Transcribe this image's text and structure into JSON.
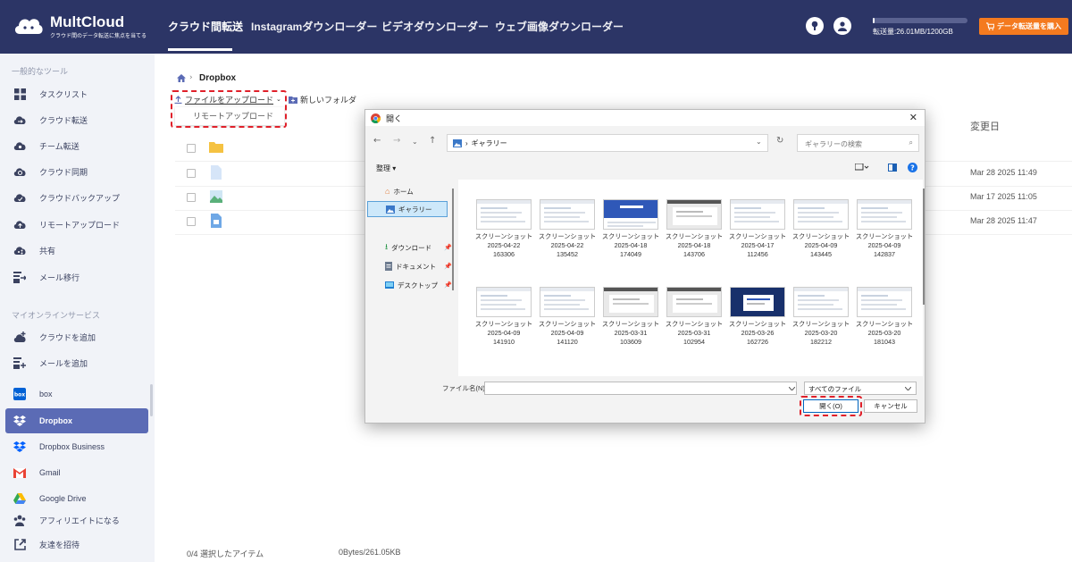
{
  "app": {
    "name": "MultCloud",
    "tagline": "クラウド間のデータ転送に焦点を当てる"
  },
  "nav": {
    "items": [
      {
        "label": "クラウド間転送",
        "active": true
      },
      {
        "label": "Instagramダウンローダー"
      },
      {
        "label": "ビデオダウンローダー"
      },
      {
        "label": "ウェブ画像ダウンローダー"
      }
    ]
  },
  "header": {
    "usage_text": "転送量:26.01MB/1200GB",
    "usage_fraction": 2e-05,
    "transfer_button": "データ転送量を購入",
    "icons": [
      "help-icon",
      "user-icon",
      "cart-icon"
    ]
  },
  "sidebar": {
    "section_tools": "一般的なツール",
    "tools": [
      {
        "label": "タスクリスト",
        "icon": "grid-icon"
      },
      {
        "label": "クラウド転送",
        "icon": "cloud-transfer-icon"
      },
      {
        "label": "チーム転送",
        "icon": "team-transfer-icon"
      },
      {
        "label": "クラウド同期",
        "icon": "cloud-sync-icon"
      },
      {
        "label": "クラウドバックアップ",
        "icon": "cloud-backup-icon"
      },
      {
        "label": "リモートアップロード",
        "icon": "remote-upload-icon"
      },
      {
        "label": "共有",
        "icon": "share-icon"
      },
      {
        "label": "メール移行",
        "icon": "mail-migrate-icon"
      }
    ],
    "section_services": "マイオンラインサービス",
    "services_actions": [
      {
        "label": "クラウドを追加",
        "icon": "add-cloud-icon"
      },
      {
        "label": "メールを追加",
        "icon": "add-mail-icon"
      }
    ],
    "services": [
      {
        "label": "box",
        "icon": "box-icon"
      },
      {
        "label": "Dropbox",
        "icon": "dropbox-icon",
        "active": true
      },
      {
        "label": "Dropbox Business",
        "icon": "dropbox-icon"
      },
      {
        "label": "Gmail",
        "icon": "gmail-icon"
      },
      {
        "label": "Google Drive",
        "icon": "google-drive-icon"
      }
    ],
    "footer": [
      {
        "label": "アフィリエイトになる",
        "icon": "affiliate-icon"
      },
      {
        "label": "友達を招待",
        "icon": "invite-icon"
      }
    ]
  },
  "main": {
    "breadcrumb": "Dropbox",
    "upload_label": "ファイルをアップロード",
    "new_folder_label": "新しいフォルダ",
    "dropdown_item": "リモートアップロード",
    "col_date": "変更日",
    "rows": [
      {
        "date": ""
      },
      {
        "date": "Mar 28 2025 11:49"
      },
      {
        "date": "Mar 17 2025 11:05"
      },
      {
        "date": "Mar 28 2025 11:47"
      }
    ],
    "status_selected": "0/4 選択したアイテム",
    "status_size": "0Bytes/261.05KB"
  },
  "dialog": {
    "title": "開く",
    "address": "ギャラリー",
    "search_placeholder": "ギャラリーの検索",
    "organize": "整理 ▾",
    "pane": [
      {
        "label": "ホーム",
        "icon": "home-icon"
      },
      {
        "label": "ギャラリー",
        "icon": "gallery-icon",
        "selected": true
      },
      {
        "label": "ダウンロード",
        "icon": "download-icon",
        "pinned": true
      },
      {
        "label": "ドキュメント",
        "icon": "document-icon",
        "pinned": true
      },
      {
        "label": "デスクトップ",
        "icon": "desktop-icon",
        "pinned": true
      }
    ],
    "files": [
      {
        "name": "スクリーンショット",
        "date": "2025-04-22",
        "time": "163306",
        "thumb": "light"
      },
      {
        "name": "スクリーンショット",
        "date": "2025-04-22",
        "time": "135452",
        "thumb": "light"
      },
      {
        "name": "スクリーンショット",
        "date": "2025-04-18",
        "time": "174049",
        "thumb": "blue"
      },
      {
        "name": "スクリーンショット",
        "date": "2025-04-18",
        "time": "143706",
        "thumb": "gray"
      },
      {
        "name": "スクリーンショット",
        "date": "2025-04-17",
        "time": "112456",
        "thumb": "light"
      },
      {
        "name": "スクリーンショット",
        "date": "2025-04-09",
        "time": "143445",
        "thumb": "light"
      },
      {
        "name": "スクリーンショット",
        "date": "2025-04-09",
        "time": "142837",
        "thumb": "light"
      },
      {
        "name": "スクリーンショット",
        "date": "2025-04-09",
        "time": "141910",
        "thumb": "light"
      },
      {
        "name": "スクリーンショット",
        "date": "2025-04-09",
        "time": "141120",
        "thumb": "light"
      },
      {
        "name": "スクリーンショット",
        "date": "2025-03-31",
        "time": "103609",
        "thumb": "gray"
      },
      {
        "name": "スクリーンショット",
        "date": "2025-03-31",
        "time": "102954",
        "thumb": "gray"
      },
      {
        "name": "スクリーンショット",
        "date": "2025-03-26",
        "time": "162726",
        "thumb": "dark"
      },
      {
        "name": "スクリーンショット",
        "date": "2025-03-20",
        "time": "182212",
        "thumb": "light"
      },
      {
        "name": "スクリーンショット",
        "date": "2025-03-20",
        "time": "181043",
        "thumb": "light"
      }
    ],
    "filename_label": "ファイル名(N):",
    "filename_value": "",
    "filetype": "すべてのファイル",
    "open_button": "開く(O)",
    "cancel_button": "キャンセル"
  },
  "colors": {
    "topbar": "#2c3566",
    "active_item": "#5b6bb5",
    "transfer_button": "#f47a1f",
    "highlight": "#e0202a"
  }
}
